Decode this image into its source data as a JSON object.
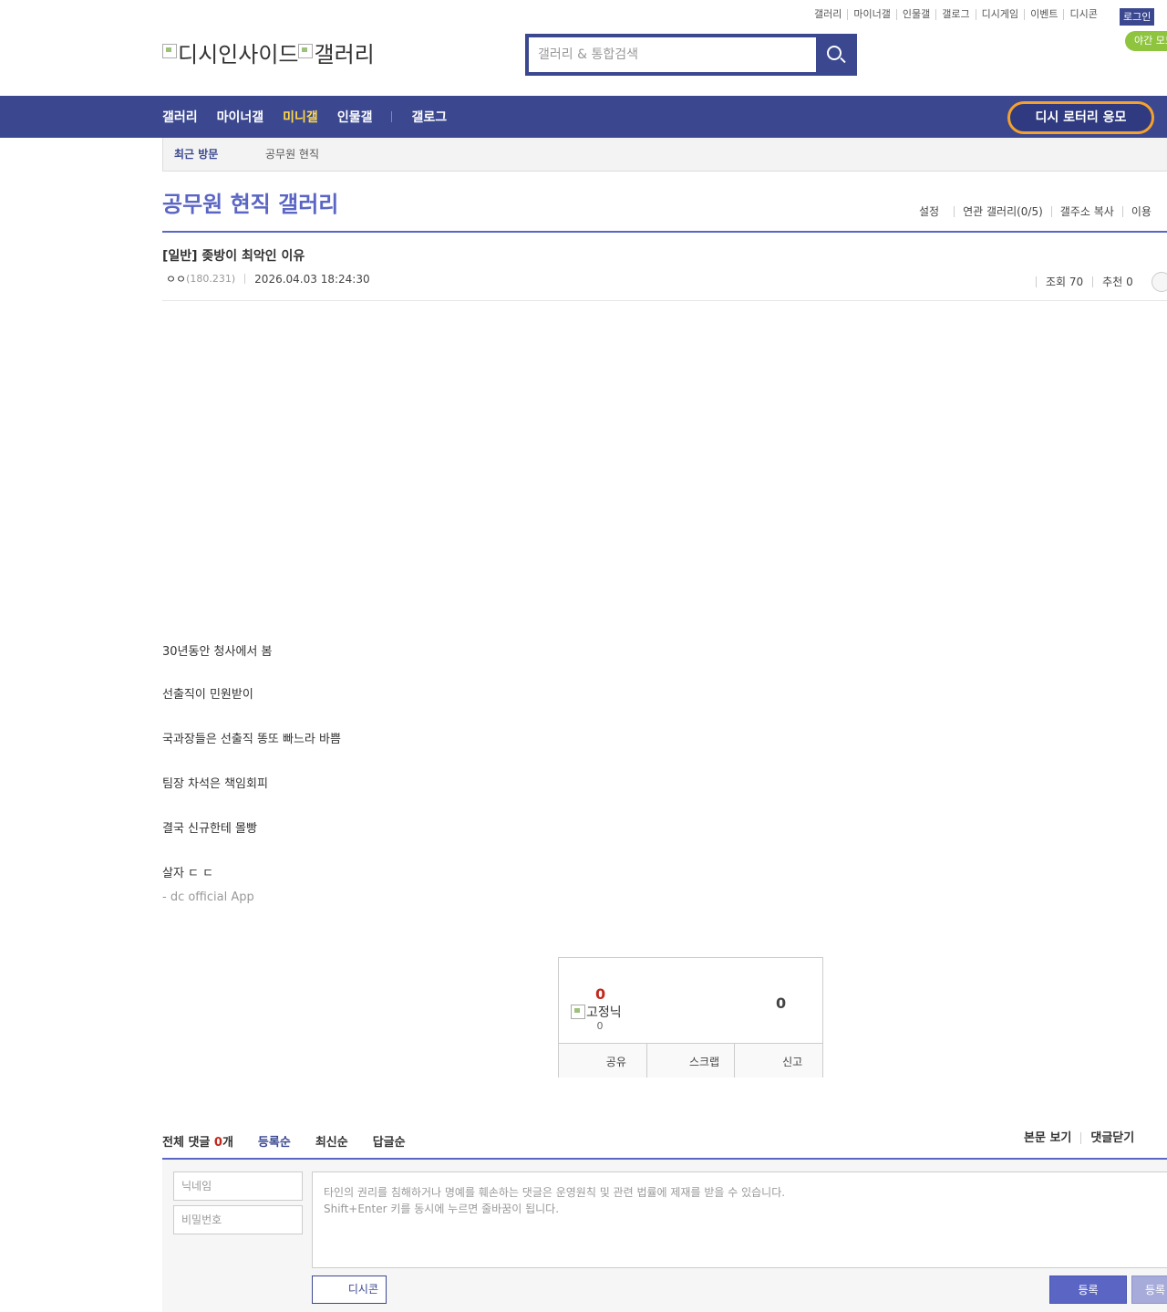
{
  "top_links": [
    "갤러리",
    "마이너갤",
    "인물갤",
    "갤로그",
    "디시게임",
    "이벤트",
    "디시콘"
  ],
  "login": "로그인",
  "night_mode": "야간 모드",
  "logo": {
    "alt1": "디시인사이드",
    "alt2": "갤러리"
  },
  "search": {
    "placeholder": "갤러리 & 통합검색"
  },
  "nav": {
    "items": [
      "갤러리",
      "마이너갤",
      "미니갤",
      "인물갤",
      "갤로그"
    ],
    "active": "미니갤",
    "lottery": "디시 로터리 응모"
  },
  "recent": {
    "label": "최근 방문",
    "item": "공무원 현직"
  },
  "gallery": {
    "title": "공무원 현직 갤러리",
    "menu": [
      "설정",
      "연관 갤러리(0/5)",
      "갤주소 복사",
      "이용"
    ]
  },
  "post": {
    "title": "[일반] 좆방이 최악인 이유",
    "nick": "ㅇㅇ",
    "ip": "(180.231)",
    "date": "2026.04.03 18:24:30",
    "views": "조회 70",
    "recommend": "추천 0",
    "body": [
      "30년동안 청사에서 봄",
      "선출직이 민원받이",
      "국과장들은 선출직 똥또 빠느라 바쁨",
      "팀장 차석은 책임회피",
      "결국 신규한테 몰빵",
      "살자 ㄷ ㄷ"
    ],
    "app_sign": "- dc official App"
  },
  "recommend_box": {
    "up_count": "0",
    "fix_alt": "고정닉",
    "fix_count": "0",
    "down_count": "0",
    "actions": [
      "공유",
      "스크랩",
      "신고"
    ]
  },
  "comments": {
    "total_prefix": "전체 댓글 ",
    "total_count": "0",
    "total_suffix": "개",
    "sorts": [
      "등록순",
      "최신순",
      "답글순"
    ],
    "right": [
      "본문 보기",
      "댓글닫기"
    ],
    "nick_placeholder": "닉네임",
    "pw_placeholder": "비밀번호",
    "textarea_placeholder": "타인의 권리를 침해하거나 명예를 훼손하는 댓글은 운영원칙 및 관련 법률에 제재를 받을 수 있습니다.\nShift+Enter 키를 동시에 누르면 줄바꿈이 됩니다.",
    "dccon": "디시콘",
    "submit": "등록",
    "submit2": "등록"
  }
}
